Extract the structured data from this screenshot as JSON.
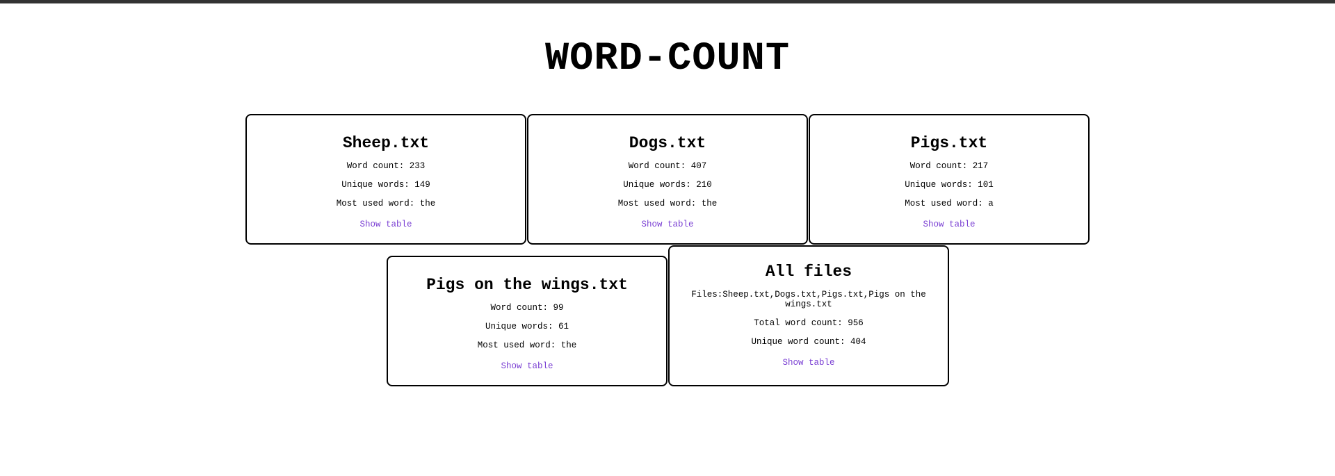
{
  "page": {
    "title": "WORD-COUNT"
  },
  "colors": {
    "top_bar": "#333333",
    "link": "#7a3fd3",
    "border": "#000000"
  },
  "cards": [
    {
      "name": "Sheep.txt",
      "word_count": "Word count: 233",
      "unique_words": "Unique words: 149",
      "most_used": "Most used word: the",
      "link": "Show table"
    },
    {
      "name": "Dogs.txt",
      "word_count": "Word count: 407",
      "unique_words": "Unique words: 210",
      "most_used": "Most used word: the",
      "link": "Show table"
    },
    {
      "name": "Pigs.txt",
      "word_count": "Word count: 217",
      "unique_words": "Unique words: 101",
      "most_used": "Most used word: a",
      "link": "Show table"
    },
    {
      "name": "Pigs on the wings.txt",
      "word_count": "Word count: 99",
      "unique_words": "Unique words: 61",
      "most_used": "Most used word: the",
      "link": "Show table"
    }
  ],
  "summary": {
    "title": "All files",
    "files": "Files:Sheep.txt,Dogs.txt,Pigs.txt,Pigs on the wings.txt",
    "total_word_count": "Total word count: 956",
    "unique_word_count": "Unique word count: 404",
    "link": "Show table"
  }
}
